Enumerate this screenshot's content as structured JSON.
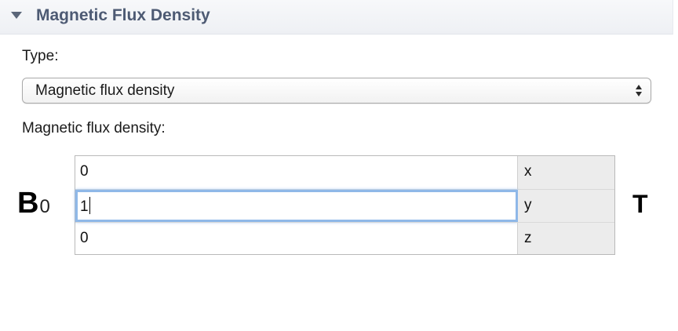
{
  "section": {
    "title": "Magnetic Flux Density",
    "icon": "triangle-down-icon"
  },
  "type_field": {
    "label": "Type:",
    "selected": "Magnetic flux density"
  },
  "flux_field": {
    "label": "Magnetic flux density:",
    "symbol_main": "B",
    "symbol_sub": "0",
    "unit": "T",
    "components": [
      {
        "axis": "x",
        "value": "0"
      },
      {
        "axis": "y",
        "value": "1"
      },
      {
        "axis": "z",
        "value": "0"
      }
    ]
  },
  "colors": {
    "header_text": "#4d5a73",
    "focus_ring": "#8fb8e8",
    "component_bg": "#ececec"
  }
}
